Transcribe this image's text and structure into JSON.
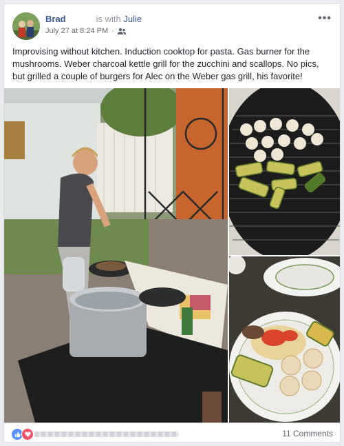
{
  "post": {
    "author": "Brad",
    "with_text": "is with",
    "with_name": "Julie",
    "timestamp": "July 27 at 8:24 PM",
    "privacy_separator": "·",
    "more_label": "•••",
    "text": "Improvising without kitchen. Induction cooktop for pasta. Gas burner for the mushrooms. Weber charcoal kettle grill for the zucchini and scallops. No pics, but grilled a couple of burgers for Alec on the Weber gas grill, his favorite!"
  },
  "footer": {
    "comments_count": "11 Comments"
  },
  "icons": {
    "privacy": "friends-icon",
    "like": "like-icon",
    "love": "love-icon",
    "more": "more-options-icon"
  },
  "colors": {
    "link": "#365899",
    "like_blue": "#5890ff",
    "love_red": "#f25268"
  }
}
